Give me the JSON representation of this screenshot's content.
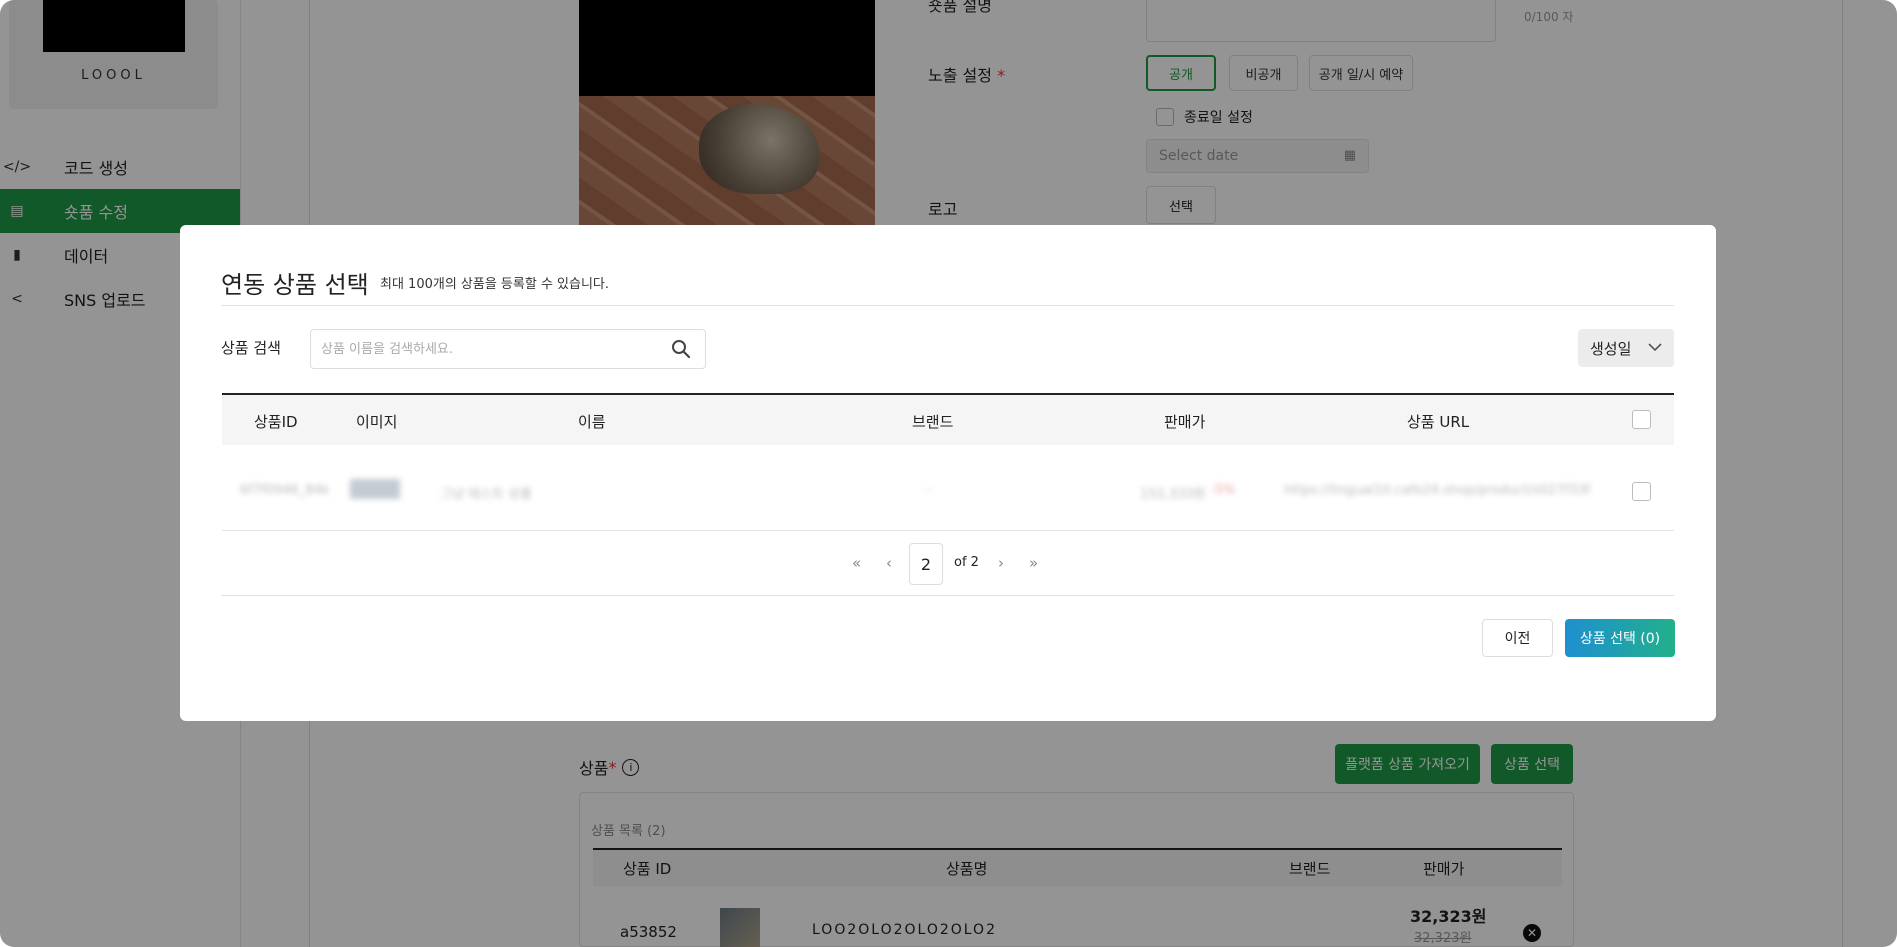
{
  "sidebar": {
    "logo_text": "LOOOL",
    "items": [
      {
        "icon": "code-icon",
        "glyph": "</>",
        "label": "코드 생성"
      },
      {
        "icon": "document-icon",
        "glyph": "▤",
        "label": "숏품 수정"
      },
      {
        "icon": "bar-chart-icon",
        "glyph": "▮",
        "label": "데이터"
      },
      {
        "icon": "share-icon",
        "glyph": "<",
        "label": "SNS 업로드"
      }
    ]
  },
  "background_form": {
    "partial_label": "숏품 설명",
    "counter": "0/100 자",
    "exposure_label": "노출 설정",
    "required_mark": "*",
    "exposure_options": [
      "공개",
      "비공개",
      "공개 일/시 예약"
    ],
    "end_date_label": "종료일 설정",
    "date_placeholder": "Select date",
    "logo_label": "로고",
    "logo_button": "선택",
    "products_label": "상품",
    "import_button": "플랫폼 상품 가져오기",
    "select_products_button": "상품 선택",
    "products_count": "상품 목록 (2)",
    "product_columns": [
      "상품 ID",
      "상품명",
      "브랜드",
      "판매가"
    ],
    "product_row": {
      "id": "a53852",
      "name": "LOO2OLO2OLO2OLO2",
      "price": "32,323원",
      "original_price": "32,323원"
    }
  },
  "modal": {
    "title": "연동 상품 선택",
    "subtitle": "최대 100개의 상품을 등록할 수 있습니다.",
    "search_label": "상품 검색",
    "search_placeholder": "상품 이름을 검색하세요.",
    "sort_value": "생성일",
    "columns": [
      "상품ID",
      "이미지",
      "이름",
      "브랜드",
      "판매가",
      "상품 URL"
    ],
    "blurred_row": {
      "id": "6f7f0946_84k",
      "name": "그냥 테스트 상품",
      "brand": "-",
      "price": "152,333원",
      "discount": "-5%",
      "url": "https://lingual10.cafe24.shop/product/s027f33f"
    },
    "pagination": {
      "current_page": "2",
      "of_text": "of 2"
    },
    "prev_button": "이전",
    "confirm_button": "상품 선택 (0)"
  },
  "colors": {
    "brand_green": "#1f9a47",
    "accent_gradient_start": "#1f8fd0",
    "accent_gradient_end": "#22b08b"
  }
}
